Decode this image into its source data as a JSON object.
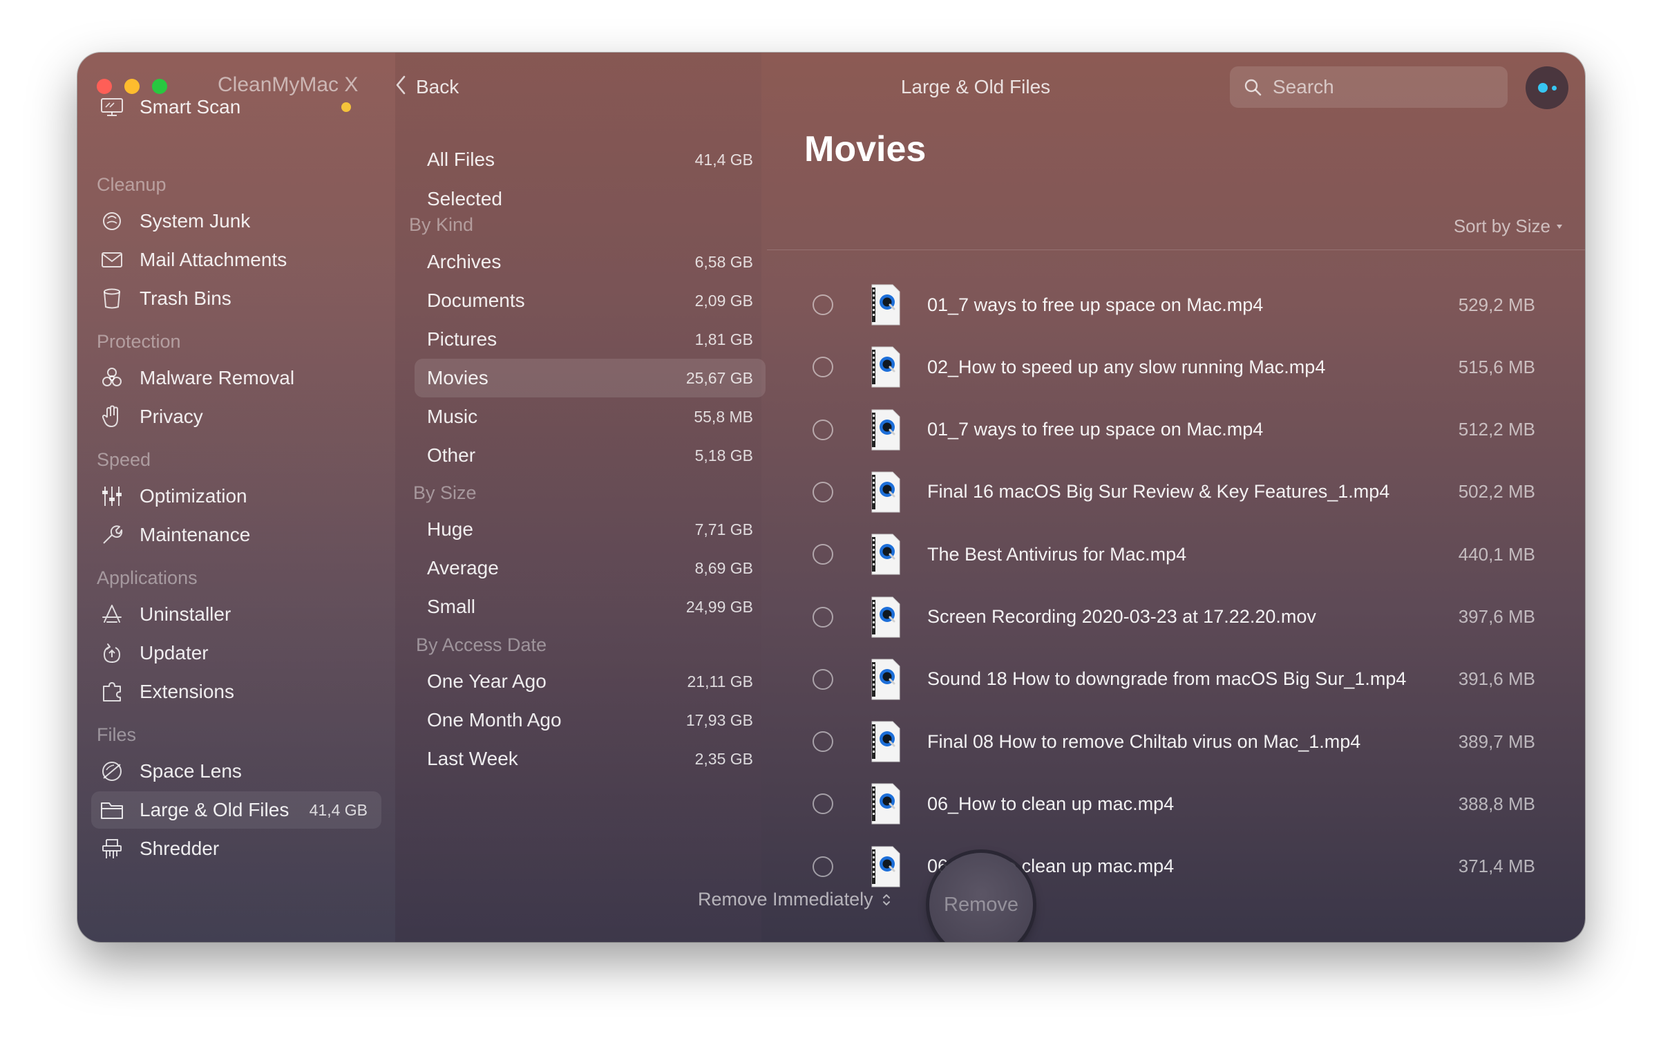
{
  "window": {
    "app_title": "CleanMyMac X",
    "back_label": "Back",
    "title": "Large & Old Files",
    "traffic_colors": [
      "#fe5f57",
      "#febc2e",
      "#28c840"
    ]
  },
  "search": {
    "placeholder": "Search"
  },
  "sidebar": {
    "smart_scan": "Smart Scan",
    "groups": [
      {
        "heading": "Cleanup",
        "items": [
          {
            "label": "System Junk",
            "icon": "system-junk-icon"
          },
          {
            "label": "Mail Attachments",
            "icon": "mail-icon"
          },
          {
            "label": "Trash Bins",
            "icon": "trash-icon"
          }
        ]
      },
      {
        "heading": "Protection",
        "items": [
          {
            "label": "Malware Removal",
            "icon": "biohazard-icon"
          },
          {
            "label": "Privacy",
            "icon": "hand-icon"
          }
        ]
      },
      {
        "heading": "Speed",
        "items": [
          {
            "label": "Optimization",
            "icon": "sliders-icon"
          },
          {
            "label": "Maintenance",
            "icon": "wrench-icon"
          }
        ]
      },
      {
        "heading": "Applications",
        "items": [
          {
            "label": "Uninstaller",
            "icon": "uninstaller-icon"
          },
          {
            "label": "Updater",
            "icon": "updater-icon"
          },
          {
            "label": "Extensions",
            "icon": "extensions-icon"
          }
        ]
      },
      {
        "heading": "Files",
        "items": [
          {
            "label": "Space Lens",
            "icon": "space-lens-icon"
          },
          {
            "label": "Large & Old Files",
            "icon": "folder-icon",
            "badge": "41,4 GB"
          },
          {
            "label": "Shredder",
            "icon": "shredder-icon"
          }
        ]
      }
    ]
  },
  "categories": {
    "all_files": {
      "label": "All Files",
      "size": "41,4 GB"
    },
    "selected": {
      "label": "Selected"
    },
    "by_kind": {
      "heading": "By Kind",
      "items": [
        {
          "label": "Archives",
          "size": "6,58 GB"
        },
        {
          "label": "Documents",
          "size": "2,09 GB"
        },
        {
          "label": "Pictures",
          "size": "1,81 GB"
        },
        {
          "label": "Movies",
          "size": "25,67 GB"
        },
        {
          "label": "Music",
          "size": "55,8 MB"
        },
        {
          "label": "Other",
          "size": "5,18 GB"
        }
      ]
    },
    "by_size": {
      "heading": "By Size",
      "items": [
        {
          "label": "Huge",
          "size": "7,71 GB"
        },
        {
          "label": "Average",
          "size": "8,69 GB"
        },
        {
          "label": "Small",
          "size": "24,99 GB"
        }
      ]
    },
    "by_access": {
      "heading": "By Access Date",
      "items": [
        {
          "label": "One Year Ago",
          "size": "21,11 GB"
        },
        {
          "label": "One Month Ago",
          "size": "17,93 GB"
        },
        {
          "label": "Last Week",
          "size": "2,35 GB"
        }
      ]
    }
  },
  "main": {
    "title": "Movies",
    "sort_label": "Sort by Size",
    "files": [
      {
        "name": "01_7 ways to free up space on Mac.mp4",
        "size": "529,2 MB",
        "type": "MPEG4"
      },
      {
        "name": "02_How to speed up any slow running Mac.mp4",
        "size": "515,6 MB",
        "type": "MPEG4"
      },
      {
        "name": "01_7 ways to free up space on Mac.mp4",
        "size": "512,2 MB",
        "type": "MPEG4"
      },
      {
        "name": "Final 16 macOS Big Sur Review & Key Features_1.mp4",
        "size": "502,2 MB",
        "type": "MPEG4"
      },
      {
        "name": "The Best Antivirus for Mac.mp4",
        "size": "440,1 MB",
        "type": "MPEG4"
      },
      {
        "name": "Screen Recording 2020-03-23 at 17.22.20.mov",
        "size": "397,6 MB",
        "type": "MOV"
      },
      {
        "name": "Sound 18 How to downgrade from macOS Big Sur_1.mp4",
        "size": "391,6 MB",
        "type": "MPEG4"
      },
      {
        "name": "Final 08 How to remove Chiltab virus on Mac_1.mp4",
        "size": "389,7 MB",
        "type": "MPEG4"
      },
      {
        "name": "06_How to clean up mac.mp4",
        "size": "388,8 MB",
        "type": "MPEG4"
      },
      {
        "name": "06_How to clean up mac.mp4",
        "size": "371,4 MB",
        "type": "MPEG4"
      }
    ]
  },
  "footer": {
    "remove_mode": "Remove Immediately",
    "remove_button": "Remove"
  }
}
